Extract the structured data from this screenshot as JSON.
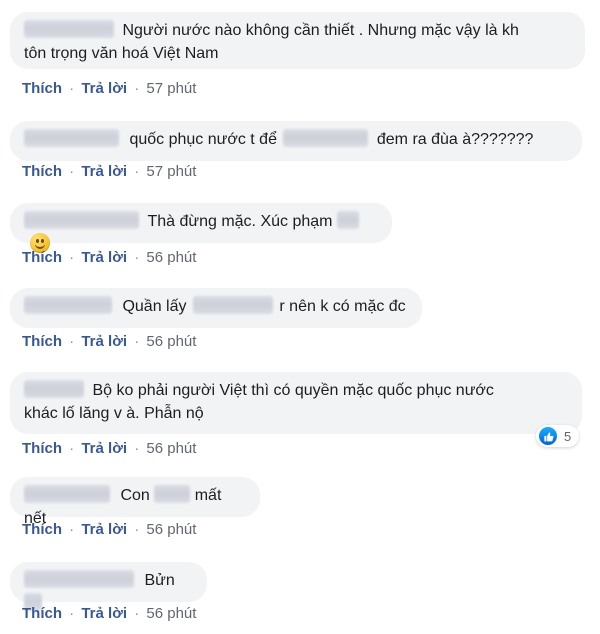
{
  "action_labels": {
    "like": "Thích",
    "reply": "Trả lời",
    "separator": "·"
  },
  "comments": [
    {
      "lines": [
        [
          "Người nước nào không cần thiết . Nhưng mặc vậy là kh"
        ],
        [
          "tôn trọng văn hoá Việt Nam"
        ]
      ],
      "time": "57 phút"
    },
    {
      "lines": [
        [
          "quốc phục nước t để",
          "đem ra đùa à???????"
        ]
      ],
      "time": "57 phút"
    },
    {
      "lines": [
        [
          "Thà đừng mặc. Xúc phạm"
        ]
      ],
      "time": "56 phút",
      "emoji": "slightly-smiling-face-emoji"
    },
    {
      "lines": [
        [
          "Quần lấy",
          "r nên k có mặc đc"
        ]
      ],
      "time": "56 phút"
    },
    {
      "lines": [
        [
          "Bộ ko phải người Việt thì có quyền mặc quốc phục nước"
        ],
        [
          "khác lố lăng v à. Phẫn nộ"
        ]
      ],
      "time": "56 phút",
      "reaction": {
        "icon": "like-icon",
        "count": "5"
      }
    },
    {
      "lines": [
        [
          "Con",
          "mất nết"
        ]
      ],
      "time": "56 phút"
    },
    {
      "lines": [
        [
          "Bửn"
        ]
      ],
      "time": "56 phút"
    }
  ]
}
